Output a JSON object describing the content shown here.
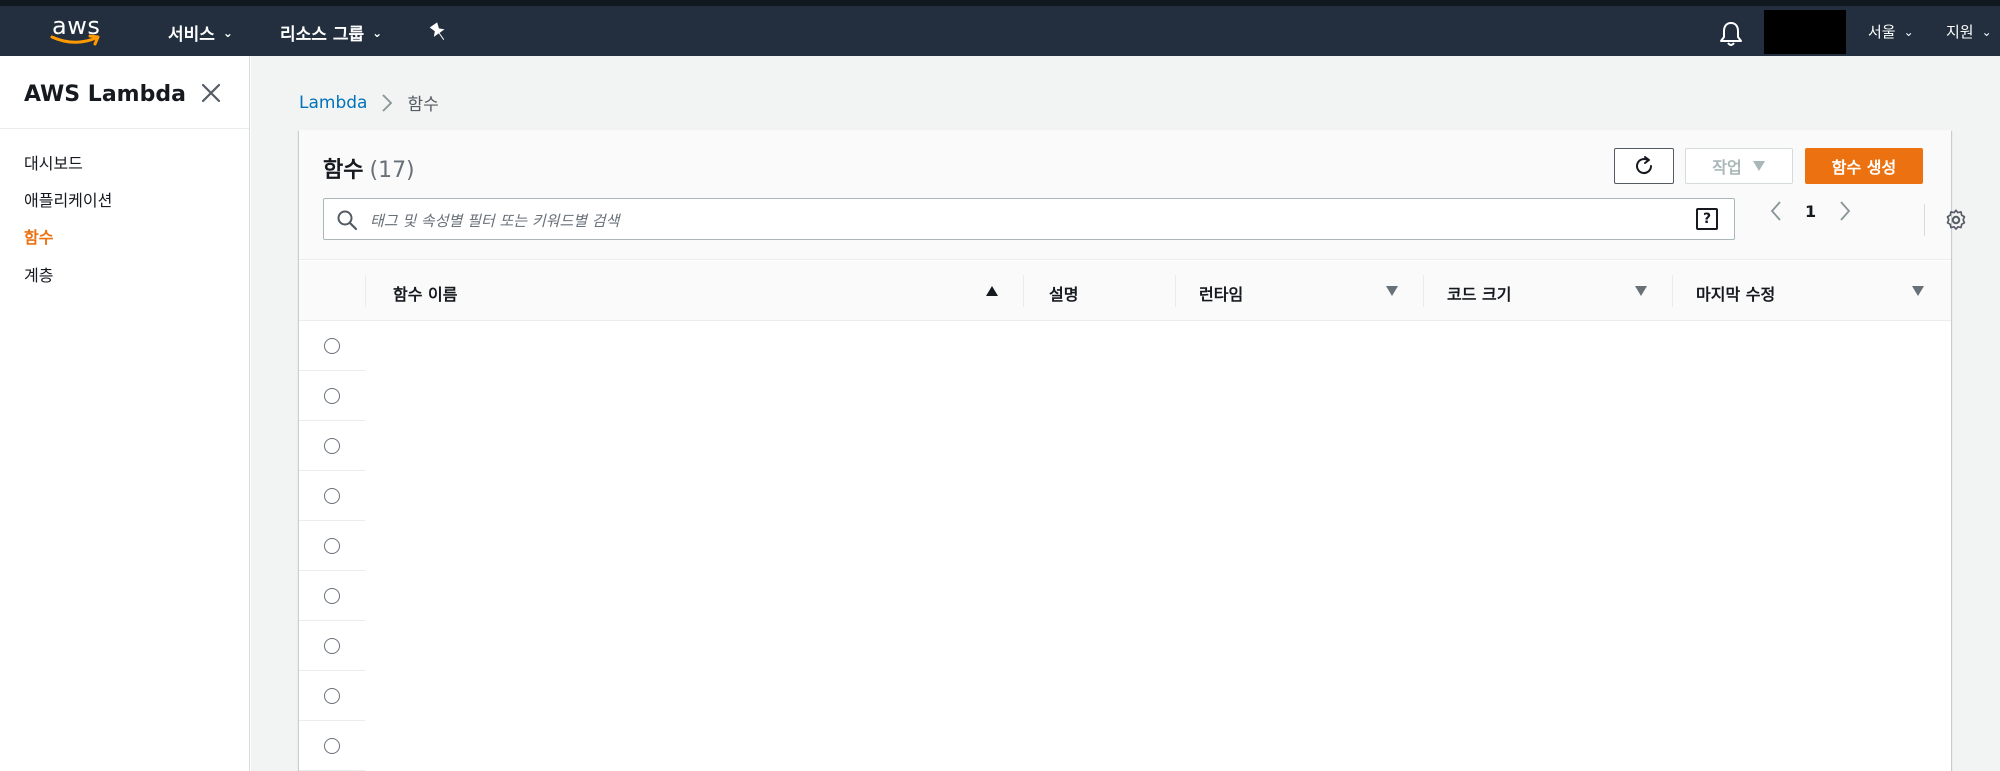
{
  "topbar": {
    "logo_text": "aws",
    "services_label": "서비스",
    "resource_groups_label": "리소스 그룹",
    "region_label": "서울",
    "support_label": "지원"
  },
  "sidebar": {
    "title": "AWS Lambda",
    "items": [
      {
        "label": "대시보드",
        "active": false
      },
      {
        "label": "애플리케이션",
        "active": false
      },
      {
        "label": "함수",
        "active": true
      },
      {
        "label": "계층",
        "active": false
      }
    ]
  },
  "breadcrumb": {
    "root": "Lambda",
    "current": "함수"
  },
  "functions_panel": {
    "title": "함수",
    "count": "(17)",
    "actions_label": "작업",
    "create_label": "함수 생성",
    "search_placeholder": "태그 및 속성별 필터 또는 키워드별 검색",
    "help_symbol": "?",
    "current_page": "1",
    "columns": [
      "함수 이름",
      "설명",
      "런타임",
      "코드 크기",
      "마지막 수정"
    ],
    "row_count": 9
  },
  "colors": {
    "navbar": "#232f3e",
    "accent": "#ec7211",
    "link": "#0073bb"
  }
}
